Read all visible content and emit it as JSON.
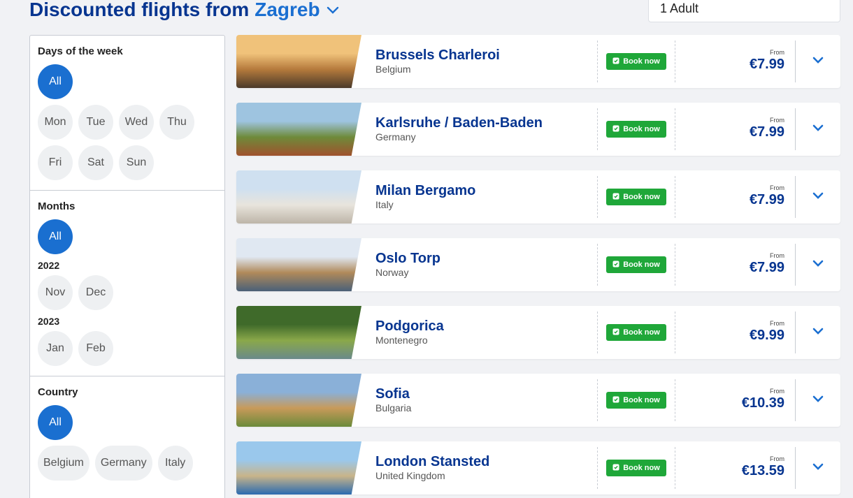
{
  "header": {
    "title_prefix": "Discounted flights from",
    "city": "Zagreb",
    "passengers": "1 Adult"
  },
  "filters": {
    "days": {
      "heading": "Days of the week",
      "all": "All",
      "items": [
        "Mon",
        "Tue",
        "Wed",
        "Thu",
        "Fri",
        "Sat",
        "Sun"
      ]
    },
    "months": {
      "heading": "Months",
      "all": "All",
      "year1": "2022",
      "year1_items": [
        "Nov",
        "Dec"
      ],
      "year2": "2023",
      "year2_items": [
        "Jan",
        "Feb"
      ]
    },
    "country": {
      "heading": "Country",
      "all": "All",
      "items": [
        "Belgium",
        "Germany",
        "Italy"
      ]
    }
  },
  "book_label": "Book now",
  "from_label": "From",
  "flights": [
    {
      "city": "Brussels Charleroi",
      "country": "Belgium",
      "price": "€7.99",
      "colors": [
        "#f0c27a",
        "#b57a3c",
        "#4a3a2a"
      ]
    },
    {
      "city": "Karlsruhe / Baden-Baden",
      "country": "Germany",
      "price": "€7.99",
      "colors": [
        "#9ec4e0",
        "#6e8a3a",
        "#a0522d"
      ]
    },
    {
      "city": "Milan Bergamo",
      "country": "Italy",
      "price": "€7.99",
      "colors": [
        "#cfe0f0",
        "#e8e4dc",
        "#bdb5a8"
      ]
    },
    {
      "city": "Oslo Torp",
      "country": "Norway",
      "price": "€7.99",
      "colors": [
        "#e0e8f2",
        "#b08a5a",
        "#4a6078"
      ]
    },
    {
      "city": "Podgorica",
      "country": "Montenegro",
      "price": "€9.99",
      "colors": [
        "#3f6a2a",
        "#8aa84a",
        "#6a8a8a"
      ]
    },
    {
      "city": "Sofia",
      "country": "Bulgaria",
      "price": "€10.39",
      "colors": [
        "#8ab0d8",
        "#c89a5a",
        "#6a8a3a"
      ]
    },
    {
      "city": "London Stansted",
      "country": "United Kingdom",
      "price": "€13.59",
      "colors": [
        "#9ac8ec",
        "#c8b48a",
        "#2a6ab0"
      ]
    }
  ]
}
